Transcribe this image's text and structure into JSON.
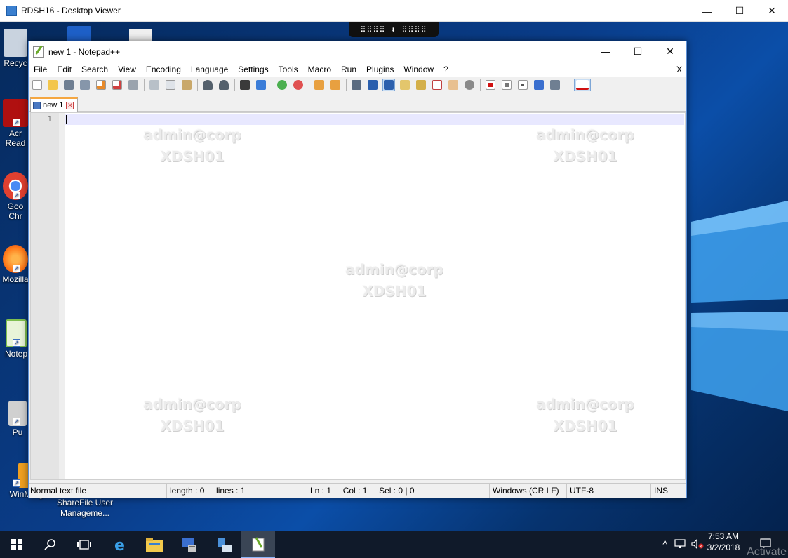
{
  "viewer": {
    "title": "RDSH16 - Desktop Viewer",
    "controls": {
      "minimize": "—",
      "maximize": "☐",
      "close": "✕"
    }
  },
  "connection_bar": {
    "label": "⠿⠿⠿⠿ ⬇ ⠿⠿⠿⠿"
  },
  "desktop_icons": [
    {
      "label": "Recyc",
      "color": "#c9d3df"
    },
    {
      "label": "Acr\nRead",
      "color": "#b01010"
    },
    {
      "label": "Goo\nChr",
      "color": "#e04030"
    },
    {
      "label": "Mozilla",
      "color": "#ff7a1a"
    },
    {
      "label": "Notep",
      "color": "#7fbf4f"
    },
    {
      "label": "Pu",
      "color": "#d0d0d0"
    },
    {
      "label": "WinMerge",
      "color": "#f0a020"
    },
    {
      "label": "ShareFile User\nManageme...",
      "color": "#dfe6ee"
    }
  ],
  "notepad": {
    "title": "new 1 - Notepad++",
    "controls": {
      "minimize": "—",
      "maximize": "☐",
      "close": "✕"
    },
    "menu": [
      "File",
      "Edit",
      "Search",
      "View",
      "Encoding",
      "Language",
      "Settings",
      "Tools",
      "Macro",
      "Run",
      "Plugins",
      "Window",
      "?"
    ],
    "menu_close": "X",
    "tab": {
      "label": "new 1",
      "close": "✕"
    },
    "line_number": "1",
    "watermark": {
      "line1": "admin@corp",
      "line2": "XDSH01"
    },
    "status": {
      "file_type": "Normal text file",
      "length": "length : 0",
      "lines": "lines : 1",
      "ln": "Ln : 1",
      "col": "Col : 1",
      "sel": "Sel : 0 | 0",
      "eol": "Windows (CR LF)",
      "encoding": "UTF-8",
      "mode": "INS"
    }
  },
  "toolbar_icons": [
    "new-file-icon",
    "open-file-icon",
    "save-icon",
    "save-all-icon",
    "close-icon",
    "close-all-icon",
    "print-icon",
    "cut-icon",
    "copy-icon",
    "paste-icon",
    "undo-icon",
    "redo-icon",
    "find-icon",
    "replace-icon",
    "zoom-in-icon",
    "zoom-out-icon",
    "sync-vertical-icon",
    "sync-horizontal-icon",
    "word-wrap-icon",
    "show-all-chars-icon",
    "indent-guide-icon",
    "user-lang-icon",
    "doc-map-icon",
    "function-list-icon",
    "folder-workspace-icon",
    "monitoring-icon",
    "record-macro-icon",
    "stop-record-icon",
    "playback-macro-icon",
    "run-macro-multiple-icon",
    "save-macro-icon",
    "spell-check-icon"
  ],
  "taskbar": {
    "items": [
      "start-icon",
      "search-icon",
      "task-view-icon",
      "ie-icon",
      "file-explorer-icon",
      "server-manager-icon",
      "network-icon",
      "notepadpp-icon"
    ],
    "clock_time": "7:53 AM",
    "clock_date": "3/2/2018",
    "activate_text": "Activate",
    "tray_up": "^"
  }
}
